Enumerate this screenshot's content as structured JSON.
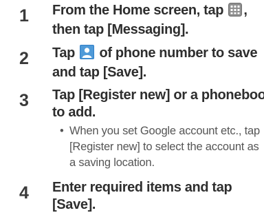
{
  "steps": [
    {
      "number": "1",
      "title_lines": [
        "From the Home screen, tap",
        ", ",
        "then tap [Messaging]."
      ],
      "icon": "apps-grid-icon"
    },
    {
      "number": "2",
      "title_parts": [
        "Tap",
        "of phone number to save"
      ],
      "title_line2": "and tap [Save].",
      "icon": "contact-avatar-icon"
    },
    {
      "number": "3",
      "title_lines": [
        "Tap [Register new] or a phonebook",
        "to add."
      ],
      "note_lines": [
        "When you set Google account etc., tap",
        "[Register new] to select the account as",
        "a saving location."
      ]
    },
    {
      "number": "4",
      "title_lines": [
        "Enter required items and tap",
        "[Save]."
      ]
    }
  ],
  "colors": {
    "text_dark": "#2e2e2e",
    "text_note": "#555555",
    "icon_blue": "#2f7fc8",
    "icon_grid": "#9a9a9a"
  }
}
